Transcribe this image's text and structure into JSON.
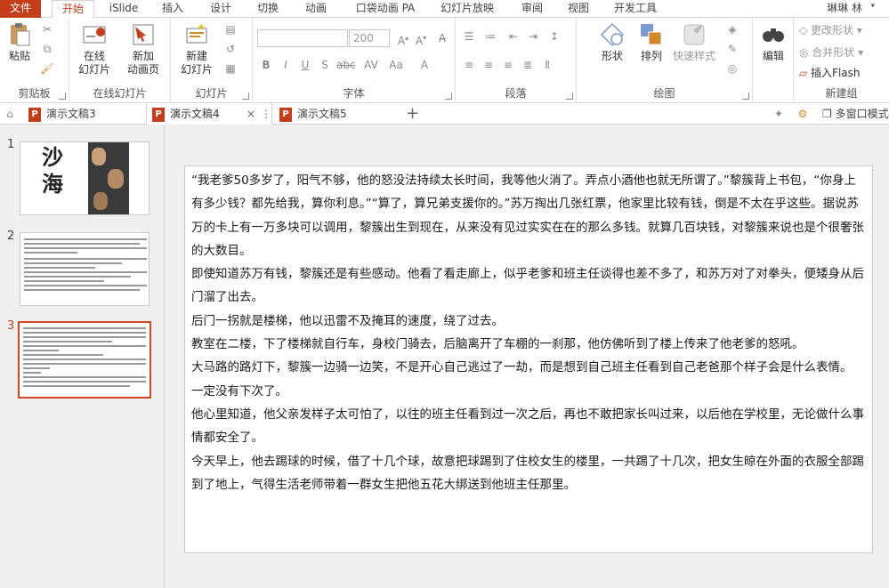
{
  "ribbon_tabs": [
    "文件",
    "开始",
    "iSlide",
    "插入",
    "设计",
    "切换",
    "动画",
    "口袋动画 PA",
    "幻灯片放映",
    "审阅",
    "视图",
    "开发工具"
  ],
  "active_tab": "开始",
  "user": "琳琳 林",
  "groups": {
    "clipboard": {
      "name": "剪贴板",
      "paste": "粘贴"
    },
    "online_slides": {
      "name": "在线幻灯片",
      "online": "在线\n幻灯片",
      "new_anim": "新加\n动画页"
    },
    "slides": {
      "name": "幻灯片",
      "new_slide": "新建\n幻灯片"
    },
    "font": {
      "name": "字体",
      "size": "200"
    },
    "paragraph": {
      "name": "段落"
    },
    "drawing": {
      "name": "绘图",
      "shape": "形状",
      "arrange": "排列",
      "quick_style": "快速样式"
    },
    "editing": {
      "name": "",
      "edit": "编辑"
    },
    "new_group": {
      "name": "新建组",
      "change_shape": "更改形状",
      "merge_shape": "合并形状",
      "insert_flash": "插入Flash"
    }
  },
  "doc_tabs": [
    {
      "label": "演示文稿3",
      "active": false
    },
    {
      "label": "演示文稿4",
      "active": true
    },
    {
      "label": "演示文稿5",
      "active": false
    }
  ],
  "multi_window": "多窗口模式",
  "thumbnails": [
    {
      "num": "1",
      "title_text": "沙海"
    },
    {
      "num": "2"
    },
    {
      "num": "3",
      "selected": true
    }
  ],
  "slide_paragraphs": [
    "“我老爹50多岁了，阳气不够，他的怒没法持续太长时间，我等他火消了。弄点小酒他也就无所谓了。”黎簇背上书包，“你身上有多少钱？都先给我，算你利息。”“算了，算兄弟支援你的。”苏万掏出几张红票，他家里比较有钱，倒是不太在乎这些。据说苏万的卡上有一万多块可以调用，黎簇出生到现在，从来没有见过实实在在的那么多钱。就算几百块钱，对黎簇来说也是个很奢张的大数目。",
    "即使知道苏万有钱，黎簇还是有些感动。他看了看走廊上，似乎老爹和班主任谈得也差不多了，和苏万对了对拳头，便矮身从后门溜了出去。",
    "后门一拐就是楼梯，他以迅雷不及掩耳的速度，绕了过去。",
    "教室在二楼，下了楼梯就自行车，身校门骑去，后脑离开了车棚的一刹那，他仿佛听到了楼上传来了他老爹的怒吼。",
    "大马路的路灯下，黎簇一边骑一边笑，不是开心自己逃过了一劫，而是想到自己班主任看到自己老爸那个样子会是什么表情。",
    "一定没有下次了。",
    "他心里知道，他父亲发样子太可怕了，以往的班主任看到过一次之后，再也不敢把家长叫过来，以后他在学校里，无论做什么事情都安全了。",
    "今天早上，他去踢球的时候，借了十几个球，故意把球踢到了住校女生的楼里，一共踢了十几次，把女生晾在外面的衣服全部踢到了地上，气得生活老师带着一群女生把他五花大绑送到他班主任那里。"
  ],
  "colors": {
    "accent": "#c43e1c",
    "selection": "#d24726"
  }
}
